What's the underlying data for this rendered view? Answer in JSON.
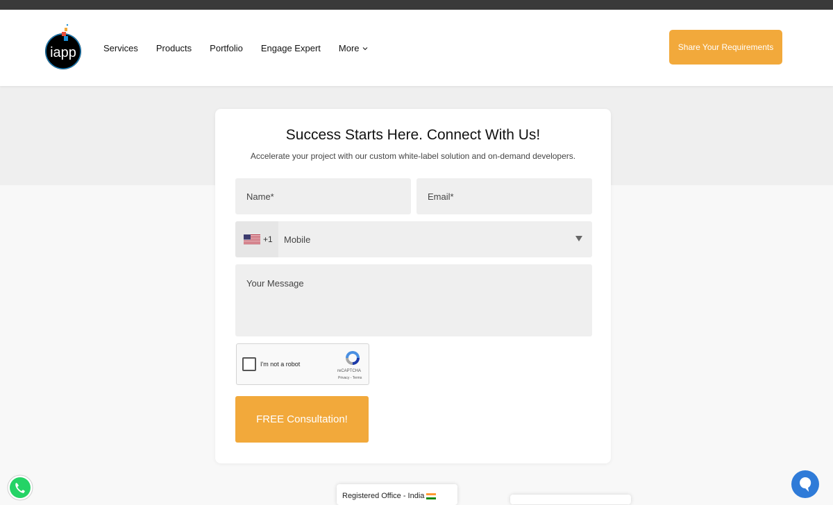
{
  "header": {
    "logo_text": "iapp",
    "nav": [
      "Services",
      "Products",
      "Portfolio",
      "Engage Expert",
      "More"
    ],
    "cta_label": "Share Your Requirements"
  },
  "form": {
    "title": "Success Starts Here. Connect With Us!",
    "subtitle": "Accelerate your project with our custom white-label solution and on-demand developers.",
    "name_placeholder": "Name*",
    "email_placeholder": "Email*",
    "phone_dial_code": "+1",
    "phone_placeholder": "Mobile",
    "message_placeholder": "Your Message",
    "captcha_label": "I'm not a robot",
    "captcha_brand": "reCAPTCHA",
    "captcha_links": "Privacy - Terms",
    "submit_label": "FREE Consultation!"
  },
  "footer": {
    "office_label": "Registered Office - India"
  },
  "colors": {
    "accent": "#f2a93b",
    "whatsapp": "#25d366",
    "chat": "#2f7bd8"
  },
  "icons": [
    "whatsapp-icon",
    "chat-icon",
    "us-flag-icon",
    "india-flag-icon",
    "recaptcha-icon",
    "chevron-down-icon"
  ]
}
